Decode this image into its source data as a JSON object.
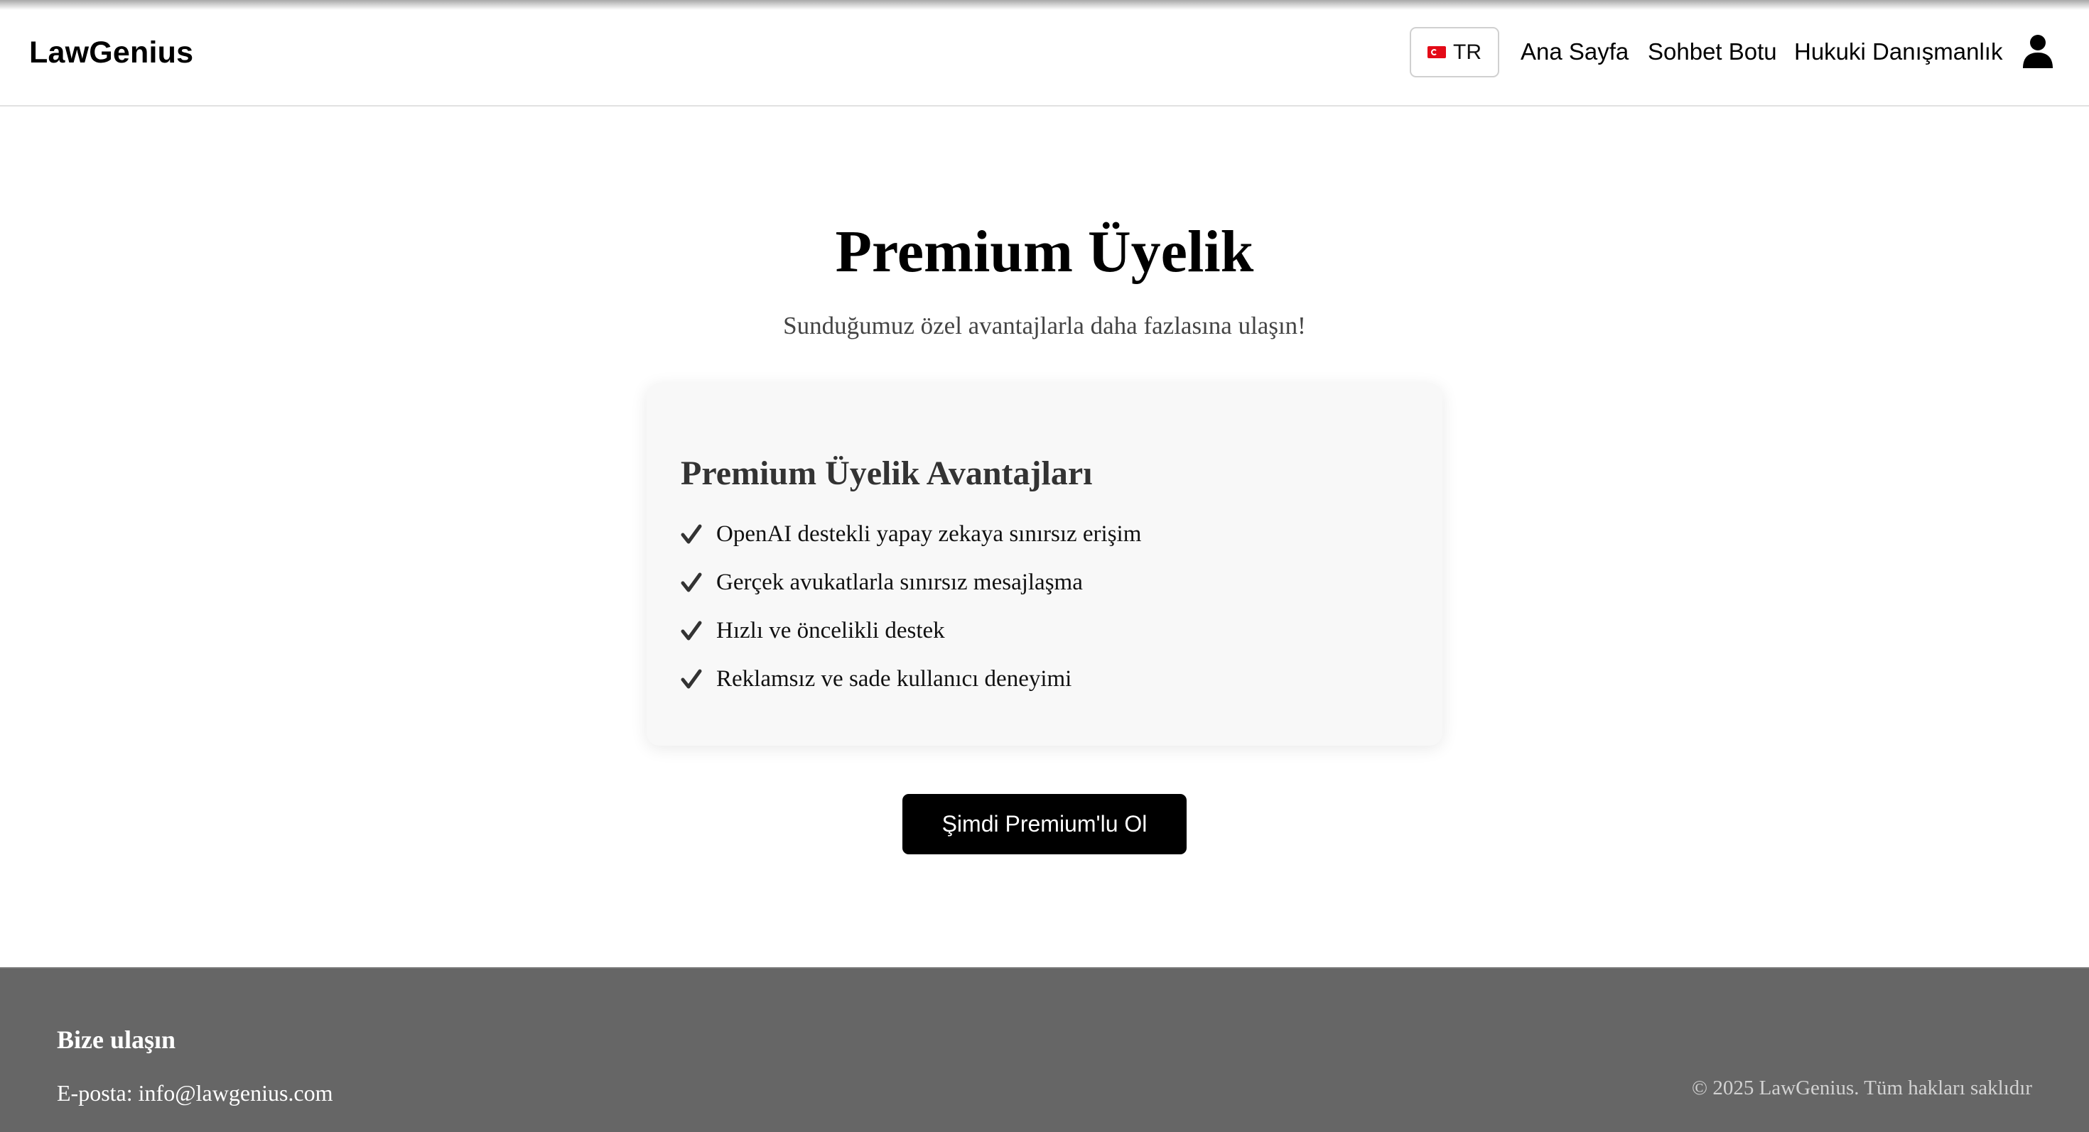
{
  "header": {
    "logo": "LawGenius",
    "language": {
      "code": "TR",
      "flag": "turkey-flag-icon"
    },
    "nav": [
      {
        "label": "Ana Sayfa"
      },
      {
        "label": "Sohbet Botu"
      },
      {
        "label": "Hukuki Danışmanlık"
      }
    ],
    "user_icon": "user-icon"
  },
  "hero": {
    "title": "Premium Üyelik",
    "subtitle": "Sunduğumuz özel avantajlarla daha fazlasına ulaşın!"
  },
  "card": {
    "title": "Premium Üyelik Avantajları",
    "benefits": [
      "OpenAI destekli yapay zekaya sınırsız erişim",
      "Gerçek avukatlarla sınırsız mesajlaşma",
      "Hızlı ve öncelikli destek",
      "Reklamsız ve sade kullanıcı deneyimi"
    ],
    "check_icon": "checkmark-icon"
  },
  "cta": {
    "label": "Şimdi Premium'lu Ol"
  },
  "footer": {
    "title": "Bize ulaşın",
    "email": "E-posta: info@lawgenius.com",
    "copyright": "© 2025 LawGenius. Tüm hakları saklıdır"
  },
  "colors": {
    "primary": "#000000",
    "footer_bg": "#666666",
    "card_bg": "#f8f8f8",
    "flag_red": "#e30a17"
  }
}
